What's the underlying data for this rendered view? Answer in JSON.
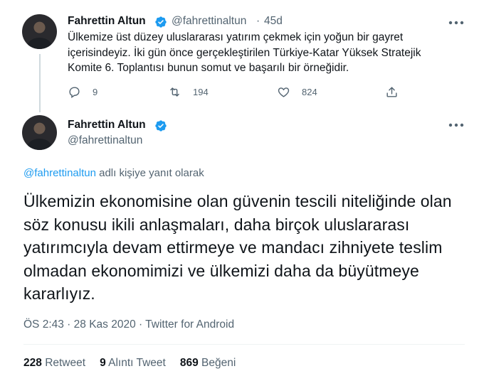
{
  "tweet_parent": {
    "author_name": "Fahrettin Altun",
    "handle": "@fahrettinaltun",
    "separator": "·",
    "time_ago": "45d",
    "text": "Ülkemize üst düzey uluslararası yatırım çekmek için yoğun bir gayret içerisindeyiz. İki gün önce gerçekleştirilen Türkiye-Katar Yüksek Stratejik Komite 6. Toplantısı bunun somut ve başarılı bir örneğidir.",
    "reply_count": "9",
    "retweet_count": "194",
    "like_count": "824"
  },
  "tweet_main": {
    "author_name": "Fahrettin Altun",
    "handle": "@fahrettinaltun",
    "reply_mention": "@fahrettinaltun",
    "reply_suffix": " adlı kişiye yanıt olarak",
    "text": "Ülkemizin ekonomisine olan güvenin tescili niteliğinde olan söz konusu ikili anlaşmaları, daha birçok uluslararası yatırımcıyla devam ettirmeye ve mandacı zihniyete teslim olmadan ekonomimizi ve ülkemizi daha da büyütmeye kararlıyız.",
    "meta": "ÖS 2:43 · 28 Kas 2020 · Twitter for Android",
    "stats": {
      "retweets_num": "228",
      "retweets_label": "Retweet",
      "quotes_num": "9",
      "quotes_label": "Alıntı Tweet",
      "likes_num": "869",
      "likes_label": "Beğeni"
    }
  },
  "colors": {
    "accent": "#1d9bf0",
    "secondary_text": "#536471",
    "primary_text": "#0f1419",
    "divider": "#eff3f4"
  }
}
